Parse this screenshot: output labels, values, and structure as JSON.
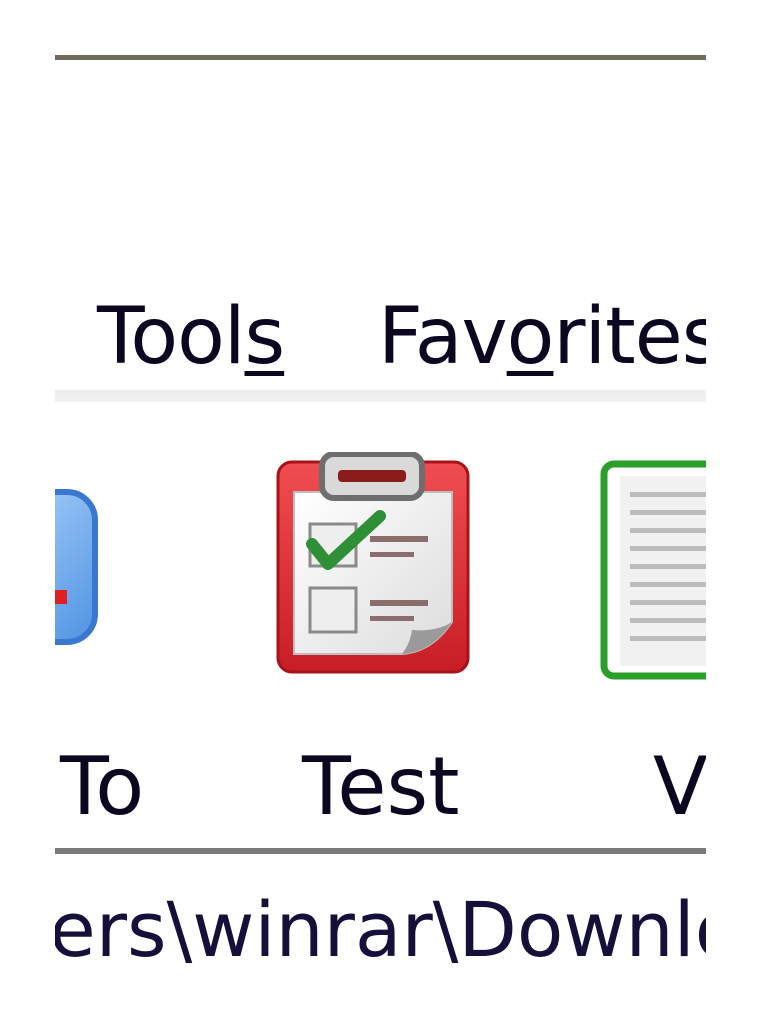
{
  "menu": {
    "tools_prefix": "Tool",
    "tools_underlined": "s",
    "favorites_prefix": "Fav",
    "favorites_underlined": "o",
    "favorites_suffix": "rites"
  },
  "toolbar": {
    "items": [
      {
        "label": "To",
        "icon": "repair-icon"
      },
      {
        "label": "Test",
        "icon": "test-clipboard-icon"
      },
      {
        "label": "V",
        "icon": "view-document-icon"
      }
    ]
  },
  "address": {
    "text": "ers\\winrar\\Downlo"
  },
  "colors": {
    "menu_text": "#0d0620",
    "separator": "#716a5e",
    "test_icon_red": "#e0282f",
    "check_green": "#2f8f36",
    "view_icon_green": "#2aa02a",
    "repair_icon_blue": "#5a9ee6"
  }
}
